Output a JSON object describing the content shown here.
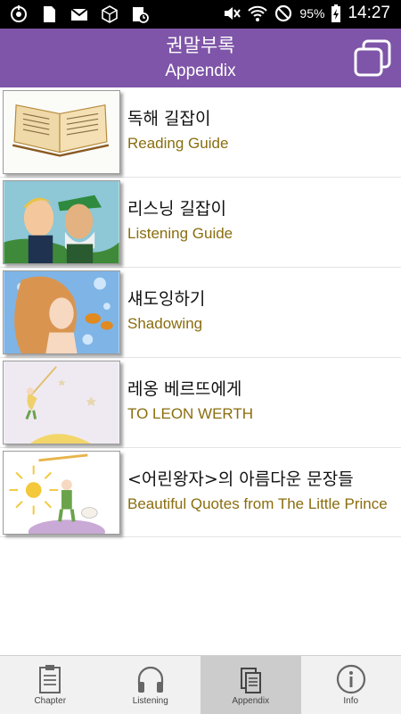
{
  "status_bar": {
    "battery": "95%",
    "time": "14:27",
    "left_icons": [
      "settings-sync-icon",
      "sim-card-icon",
      "gmail-icon",
      "network-cube-icon",
      "calendar-clock-icon"
    ],
    "right_icons": [
      "mute-icon",
      "wifi-icon",
      "blocked-icon",
      "battery-charging-icon"
    ]
  },
  "header": {
    "title_ko": "권말부록",
    "title_en": "Appendix",
    "bg_color": "#7e55a8"
  },
  "items": [
    {
      "ko": "독해 길잡이",
      "en": "Reading Guide"
    },
    {
      "ko": "리스닝 길잡이",
      "en": "Listening Guide"
    },
    {
      "ko": "섀도잉하기",
      "en": "Shadowing"
    },
    {
      "ko": "레옹 베르뜨에게",
      "en": "TO LEON WERTH"
    },
    {
      "ko": "<어린왕자>의 아름다운 문장들",
      "en": "Beautiful Quotes from The Little Prince"
    }
  ],
  "bottom_nav": [
    {
      "label": "Chapter",
      "icon": "clipboard-icon",
      "active": false
    },
    {
      "label": "Listening",
      "icon": "headphones-icon",
      "active": false
    },
    {
      "label": "Appendix",
      "icon": "documents-icon",
      "active": true
    },
    {
      "label": "Info",
      "icon": "info-icon",
      "active": false
    }
  ]
}
